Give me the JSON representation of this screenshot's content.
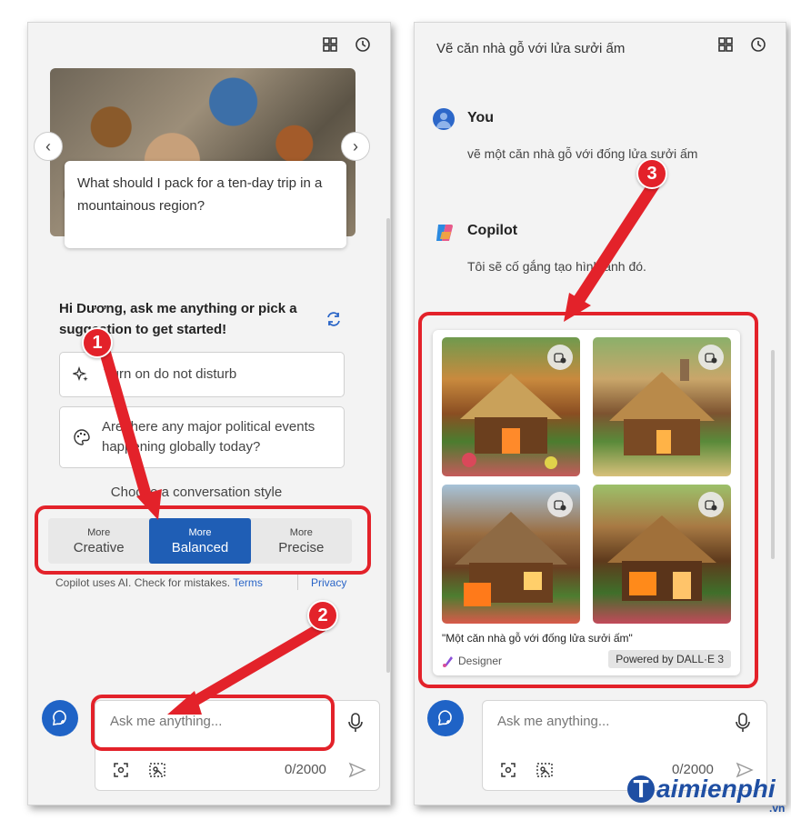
{
  "left_panel": {
    "suggestion_card_text": "What should I pack for a ten-day trip in a mountainous region?",
    "greeting": "Hi Dương, ask me anything or pick a suggestion to get started!",
    "prompts": [
      {
        "icon": "sparkle-icon",
        "label": "Turn on do not disturb"
      },
      {
        "icon": "palette-icon",
        "label": "Are there any major political events happening globally today?"
      }
    ],
    "style_label": "Choose a conversation style",
    "styles": [
      {
        "small": "More",
        "big": "Creative",
        "active": false
      },
      {
        "small": "More",
        "big": "Balanced",
        "active": true
      },
      {
        "small": "More",
        "big": "Precise",
        "active": false
      }
    ],
    "disclaimer_text": "Copilot uses AI. Check for mistakes. ",
    "terms_label": "Terms",
    "privacy_label": "Privacy",
    "input_placeholder": "Ask me anything...",
    "counter": "0/2000"
  },
  "right_panel": {
    "title": "Vẽ căn nhà gỗ với lửa sưởi ấm",
    "user_name": "You",
    "user_message": "vẽ một căn nhà gỗ với đống lửa sưởi ấm",
    "bot_name": "Copilot",
    "bot_message": "Tôi sẽ cố gắng tạo hình ảnh đó.",
    "image_caption": "\"Một căn nhà gỗ với đống lửa sưởi ấm\"",
    "designer_label": "Designer",
    "dalle_label": "Powered by DALL·E 3",
    "input_placeholder": "Ask me anything...",
    "counter": "0/2000"
  },
  "annotations": {
    "badges": [
      "1",
      "2",
      "3"
    ],
    "accent_color": "#e3222a"
  },
  "colors": {
    "copilot_blue": "#1f5eb5",
    "panel_bg": "#f3f3f3"
  },
  "watermark": {
    "text": "aimienphi",
    "initial": "T",
    "suffix": ".vn"
  }
}
